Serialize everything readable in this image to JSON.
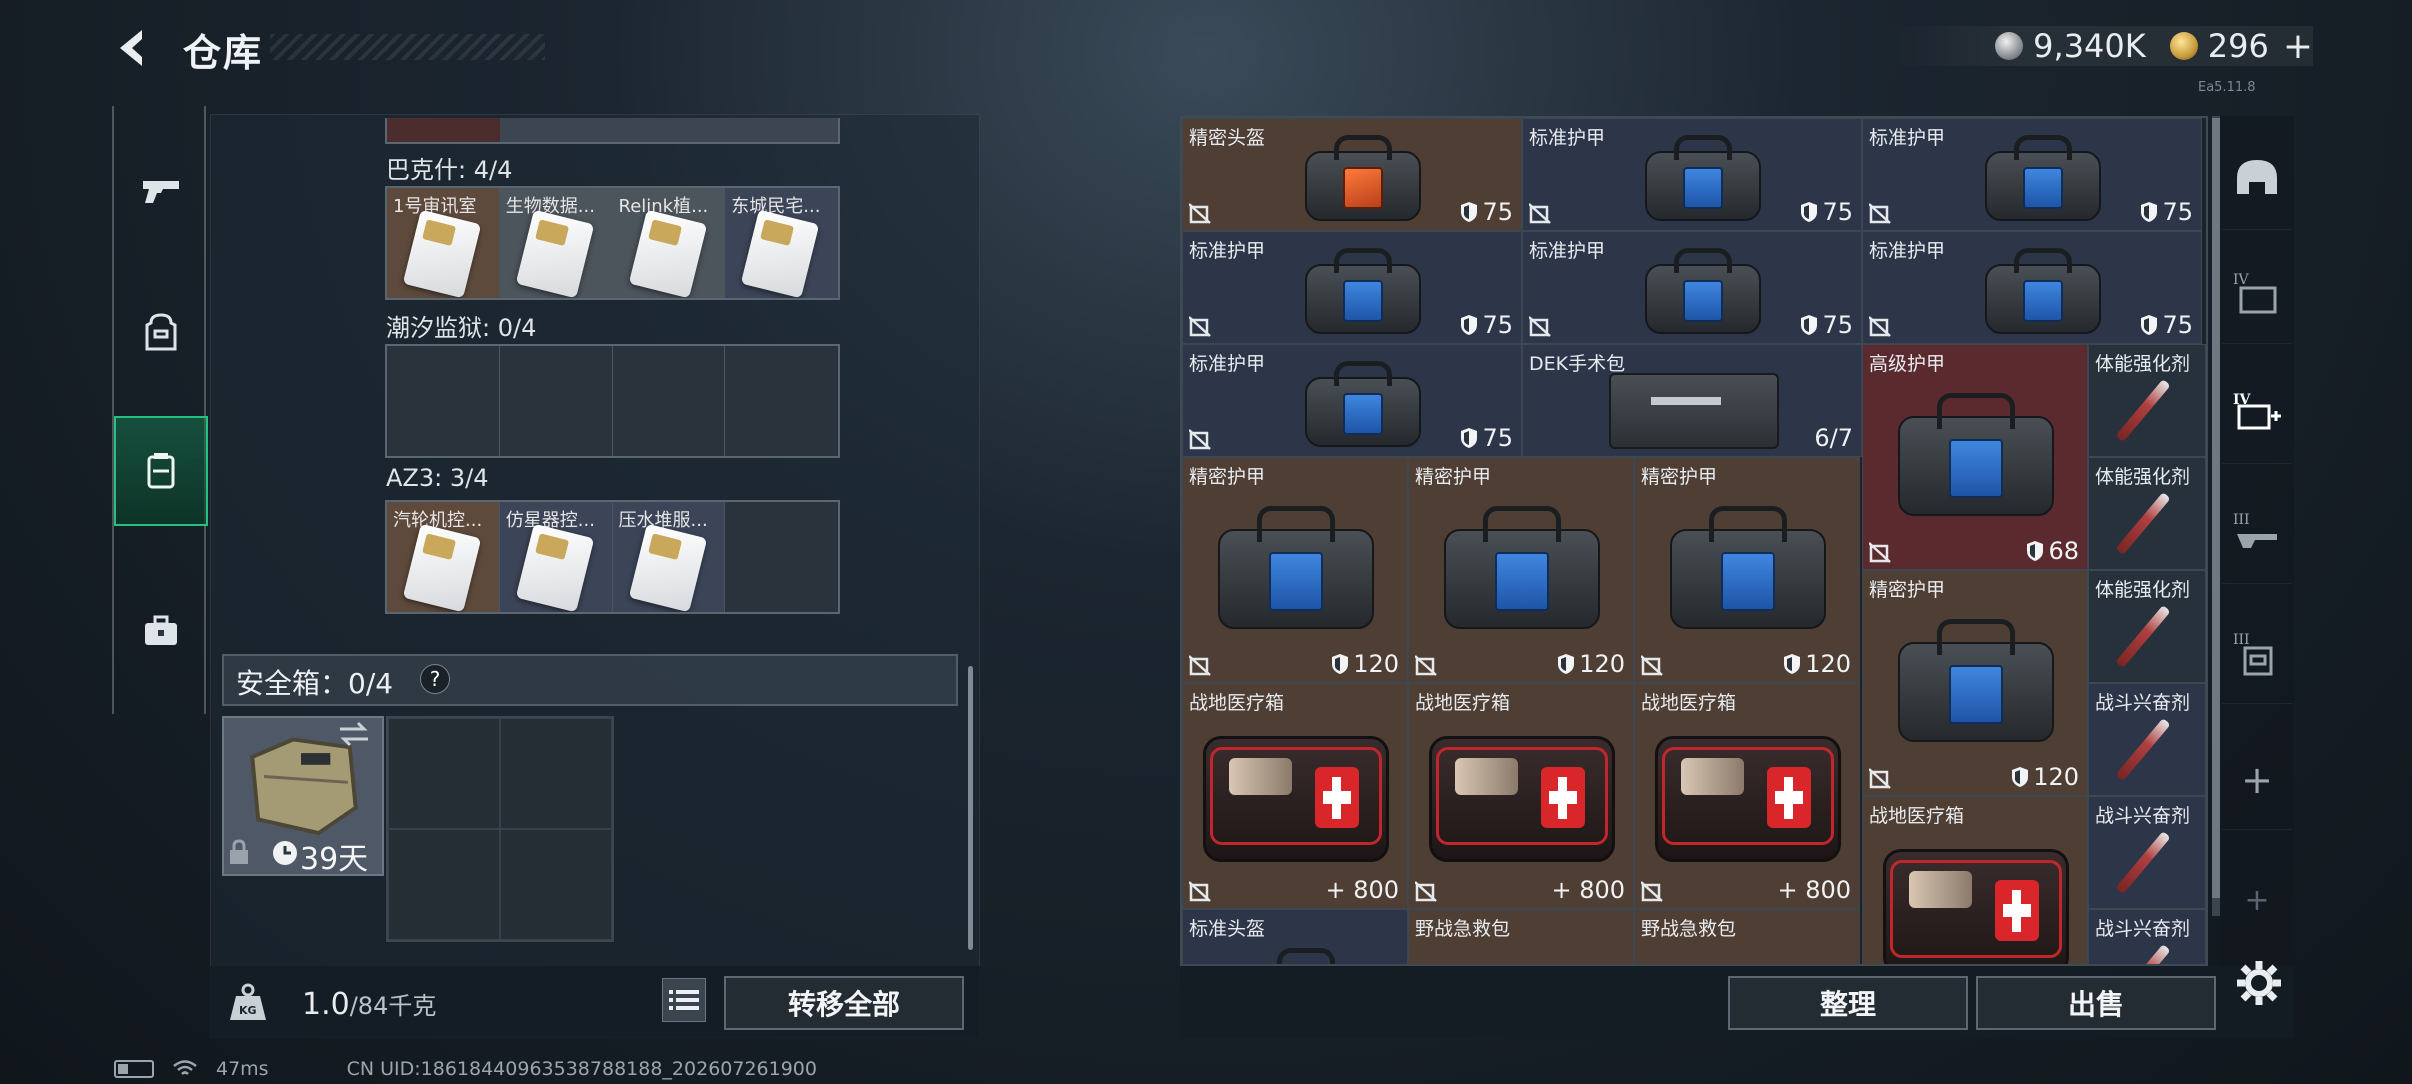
{
  "header": {
    "title": "仓库"
  },
  "currency": {
    "silver": "9,340K",
    "gold": "296",
    "gold_add": "+"
  },
  "version_text": "Ea5.11.8",
  "left_nav": [
    "pistol-icon",
    "backpack-icon",
    "container-icon",
    "briefcase-icon"
  ],
  "stash_groups": [
    {
      "label": "巴克什: 4/4",
      "cards": [
        "1号审讯室",
        "生物数据...",
        "Relink植...",
        "东城民宅..."
      ]
    },
    {
      "label": "潮汐监狱: 0/4",
      "cards": []
    },
    {
      "label": "AZ3: 3/4",
      "cards": [
        "汽轮机控...",
        "仿星器控...",
        "压水堆服..."
      ]
    }
  ],
  "safe": {
    "label": "安全箱：0/4",
    "help": "?",
    "days": "39天"
  },
  "weight": {
    "current": "1.0",
    "max": "/84千克"
  },
  "buttons": {
    "transfer_all": "转移全部",
    "organize": "整理",
    "sell": "出售"
  },
  "inventory": {
    "items": [
      {
        "name": "精密头盔",
        "stat": "75"
      },
      {
        "name": "标准护甲",
        "stat": "75"
      },
      {
        "name": "标准护甲",
        "stat": "75"
      },
      {
        "name": "标准护甲",
        "stat": "75"
      },
      {
        "name": "标准护甲",
        "stat": "75"
      },
      {
        "name": "标准护甲",
        "stat": "75"
      },
      {
        "name": "标准护甲",
        "stat": "75"
      },
      {
        "name": "DEK手术包",
        "stat": "6/7"
      },
      {
        "name": "高级护甲",
        "stat": "68"
      },
      {
        "name": "体能强化剂",
        "stat": ""
      },
      {
        "name": "精密护甲",
        "stat": "120"
      },
      {
        "name": "精密护甲",
        "stat": "120"
      },
      {
        "name": "精密护甲",
        "stat": "120"
      },
      {
        "name": "体能强化剂",
        "stat": ""
      },
      {
        "name": "精密护甲",
        "stat": "120"
      },
      {
        "name": "体能强化剂",
        "stat": ""
      },
      {
        "name": "战地医疗箱",
        "stat": "800"
      },
      {
        "name": "战地医疗箱",
        "stat": "800"
      },
      {
        "name": "战地医疗箱",
        "stat": "800"
      },
      {
        "name": "战斗兴奋剂",
        "stat": ""
      },
      {
        "name": "战地医疗箱",
        "stat": ""
      },
      {
        "name": "战斗兴奋剂",
        "stat": ""
      },
      {
        "name": "标准头盔",
        "stat": ""
      },
      {
        "name": "野战急救包",
        "stat": ""
      },
      {
        "name": "野战急救包",
        "stat": ""
      },
      {
        "name": "战斗兴奋剂",
        "stat": ""
      }
    ]
  },
  "medkit_prefix": "+",
  "status": {
    "ping": "47ms",
    "uid": "CN UID:18618440963538788188_202607261900"
  }
}
